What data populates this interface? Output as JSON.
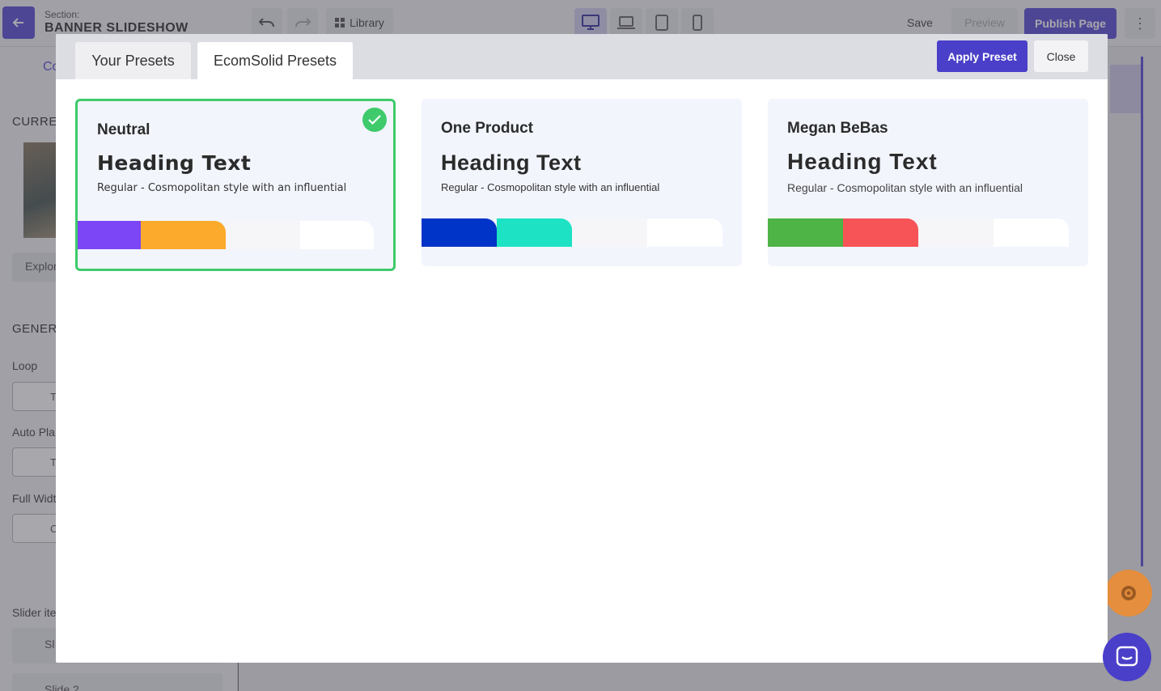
{
  "editor": {
    "section_prefix": "Section:",
    "section_name": "BANNER SLIDESHOW",
    "library_label": "Library",
    "save_label": "Save",
    "preview_label": "Preview",
    "publish_label": "Publish Page"
  },
  "sidebar": {
    "tab_label": "Co",
    "current_heading": "CURREN",
    "explore_label": "Explor",
    "general_heading": "GENERA",
    "loop_label": "Loop",
    "loop_value": "T",
    "autoplay_label": "Auto Pla",
    "autoplay_value": "T",
    "fullwidth_label": "Full Widt",
    "fullwidth_value": "C",
    "slider_items_label": "Slider ite",
    "slide_1_label": "Sl",
    "slide_2_label": "Slide 2"
  },
  "modal": {
    "tabs": [
      {
        "label": "Your Presets",
        "active": false
      },
      {
        "label": "EcomSolid Presets",
        "active": true
      }
    ],
    "apply_label": "Apply Preset",
    "close_label": "Close",
    "presets": [
      {
        "name": "Neutral",
        "heading": "Heading Text",
        "description": "Regular - Cosmopolitan style with an influential",
        "selected": true,
        "colors": [
          "#7c45f5",
          "#fbaa2b",
          "#f6f6f8",
          "#ffffff"
        ]
      },
      {
        "name": "One Product",
        "heading": "Heading Text",
        "description": "Regular - Cosmopolitan style with an influential",
        "selected": false,
        "colors": [
          "#0033c7",
          "#1de2c3",
          "#f6f6f8",
          "#ffffff"
        ]
      },
      {
        "name": "Megan BeBas",
        "heading": "Heading Text",
        "description": "Regular - Cosmopolitan style with an influential",
        "selected": false,
        "colors": [
          "#4db445",
          "#f65456",
          "#f6f6f8",
          "#ffffff"
        ]
      }
    ]
  },
  "icons": {
    "back": "arrow-left-icon",
    "undo": "undo-icon",
    "redo": "redo-icon",
    "library": "grid-icon",
    "desktop": "desktop-icon",
    "laptop": "laptop-icon",
    "tablet": "tablet-icon",
    "mobile": "mobile-icon",
    "more": "more-vertical-icon",
    "check": "check-icon",
    "gear": "gear-icon",
    "chat": "chat-icon"
  },
  "accent_color": "#4a3fc8",
  "selected_color": "#3fca6b"
}
